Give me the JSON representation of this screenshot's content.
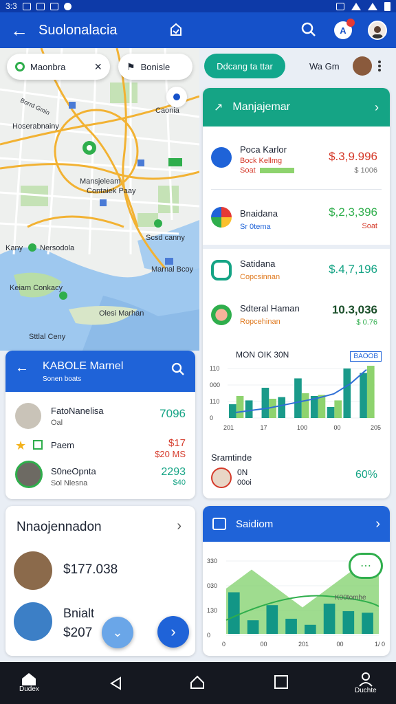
{
  "status_bar": {
    "time": "3:3"
  },
  "app_bar": {
    "title": "Suolonalacia"
  },
  "map": {
    "chips": [
      {
        "label": "Maonbra"
      },
      {
        "label": "Bonisle"
      }
    ],
    "labels": [
      "Caonia",
      "Borrd Gmin",
      "Hoserabnainy",
      "Mansjeleam",
      "Contaiek Paay",
      "Kany",
      "Nersodola",
      "Scsd canny",
      "Marnal Bcoy",
      "Keiam Conkacy",
      "Olesi Marhan",
      "Sttlal Ceny"
    ]
  },
  "right_header": {
    "pill_label": "Ddcang ta ttar",
    "name": "Wa Gm"
  },
  "management": {
    "title": "Manjajemar",
    "items": [
      {
        "title": "Poca Karlor",
        "sub": "Bock Kellmg",
        "sub2": "Soat",
        "value": "$.3,9.996",
        "value2": "$ 1006"
      },
      {
        "title": "Bnaidana",
        "sub": "Sr 0tema",
        "value": "$,2,3,396",
        "value2": "Soat"
      },
      {
        "title": "Satidana",
        "sub": "Copcsinnan",
        "value": "$.4,7,196"
      },
      {
        "title": "Sdteral Haman",
        "sub": "Ropcehinan",
        "value": "10.3,036",
        "value2": "$ 0.76"
      }
    ],
    "chart": {
      "title": "MON OIK 30N",
      "badge": "BAOOB",
      "y_ticks": [
        "110",
        "000",
        "110",
        "0"
      ],
      "x_ticks": [
        "201",
        "17",
        "100",
        "00",
        "205"
      ]
    },
    "footer": {
      "title": "Sramtinde",
      "sub": "0N",
      "sub2": "00oi",
      "value": "60%"
    }
  },
  "market": {
    "title": "KABOLE Marnel",
    "subtitle": "Sonen boats",
    "items": [
      {
        "title": "FatoNanelisa",
        "sub": "Oal",
        "value": "7096"
      },
      {
        "title": "Paem",
        "value": "$17",
        "value2": "$20 MS"
      },
      {
        "title": "S0neOpnta",
        "sub": "Sol Nlesna",
        "value": "2293",
        "value2": "$40"
      }
    ]
  },
  "negotiation": {
    "title": "Nnaojennadon",
    "items": [
      {
        "value": "$177.038"
      },
      {
        "title": "Bnialt",
        "value": "$207"
      }
    ]
  },
  "settings_card": {
    "title": "Saidiom",
    "y_ticks": [
      "330",
      "030",
      "130",
      "0"
    ],
    "x_ticks": [
      "0",
      "00",
      "201",
      "00",
      "1/ 0"
    ],
    "annotation": "K00tomhe"
  },
  "nav": [
    {
      "label": "Dudex"
    },
    {
      "label": ""
    },
    {
      "label": ""
    },
    {
      "label": ""
    },
    {
      "label": "Duchte"
    }
  ],
  "colors": {
    "primary": "#1551c9",
    "teal": "#15a485",
    "red": "#d53a2a",
    "green": "#2fae4c"
  },
  "chart_data": [
    {
      "type": "bar",
      "title": "MON OIK 30N",
      "categories": [
        "201",
        "",
        "17",
        "",
        "100",
        "",
        "00",
        "",
        "205"
      ],
      "series": [
        {
          "values": [
            25,
            32,
            55,
            38,
            72,
            40,
            20,
            90,
            82
          ]
        },
        {
          "values": [
            40,
            0,
            35,
            0,
            45,
            42,
            32,
            0,
            95
          ]
        }
      ],
      "line": [
        10,
        14,
        18,
        24,
        30,
        36,
        44,
        62,
        88
      ]
    },
    {
      "type": "area",
      "title": "Saidiom",
      "x": [
        "0",
        "00",
        "201",
        "00",
        "1/ 0"
      ],
      "area": [
        60,
        85,
        60,
        35,
        60,
        85,
        95
      ],
      "bars": [
        55,
        18,
        38,
        20,
        12,
        40,
        30,
        28
      ]
    }
  ]
}
